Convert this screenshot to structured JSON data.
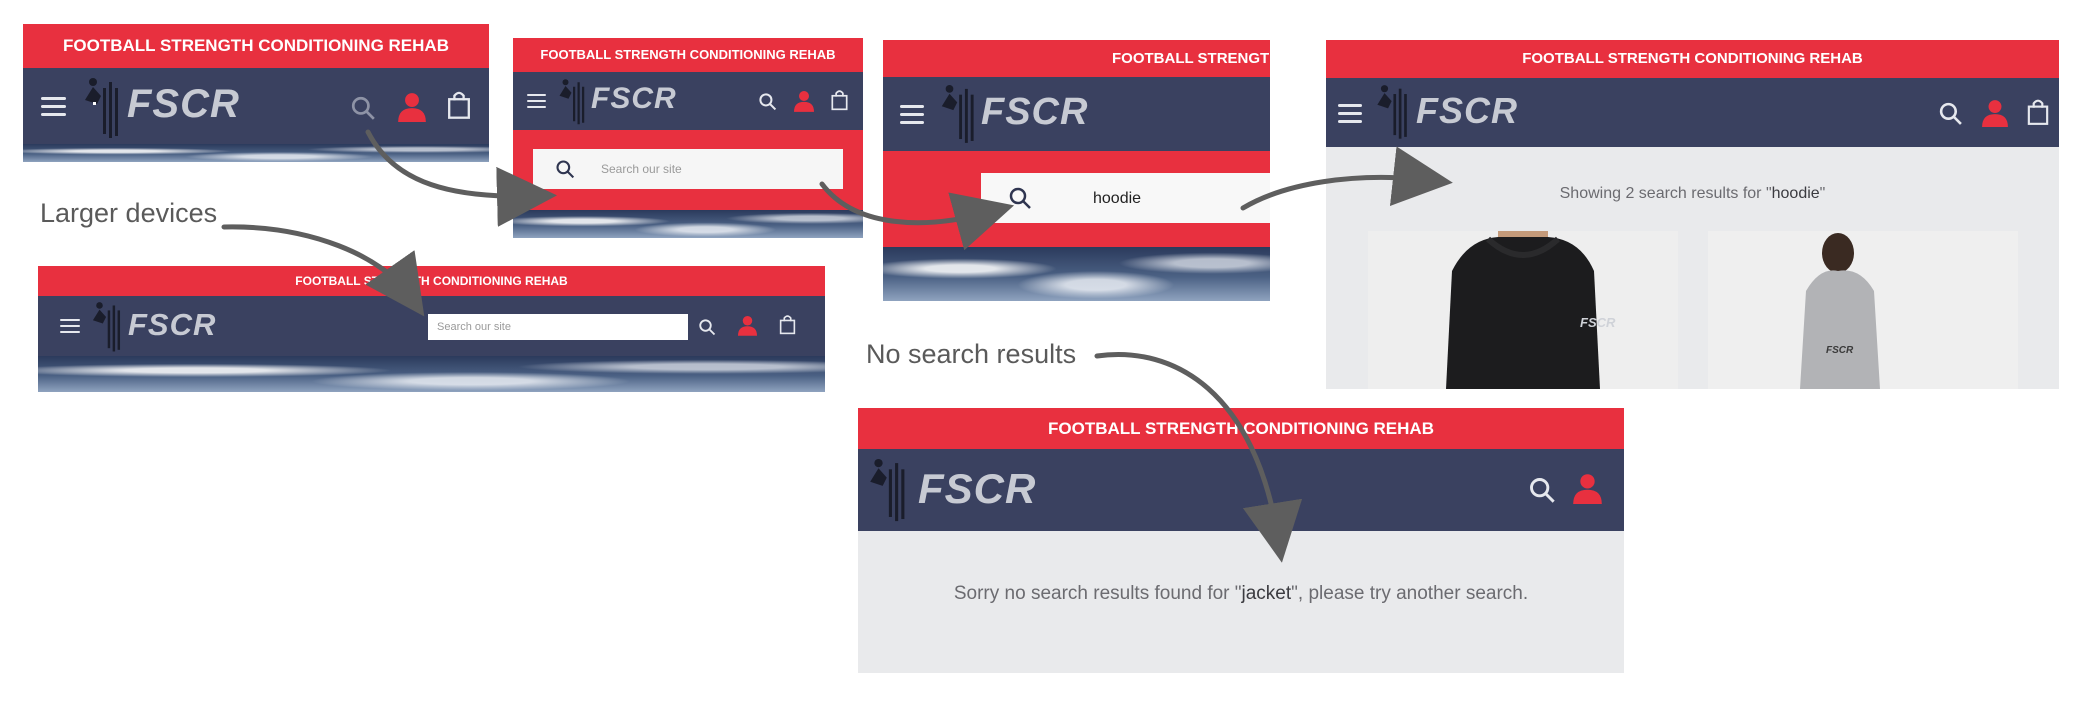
{
  "brand": {
    "promo_text": "FOOTBALL STRENGTH CONDITIONING REHAB",
    "logo_text": "FSCR",
    "colors": {
      "promo_red": "#e8303f",
      "nav_navy": "#3a4160",
      "panel_gray": "#e9eaec"
    }
  },
  "captions": {
    "larger_devices": "Larger devices",
    "no_results": "No search results"
  },
  "search": {
    "placeholder": "Search our site",
    "query_value": "hoodie"
  },
  "results": {
    "prefix": "Showing 2 search results for \"",
    "term": "hoodie",
    "suffix": "\""
  },
  "no_results_message": {
    "prefix": "Sorry no search results found for \"",
    "term": "jacket",
    "suffix": "\", please try another search."
  },
  "icons": [
    "menu-icon",
    "search-icon",
    "account-icon",
    "bag-icon"
  ]
}
